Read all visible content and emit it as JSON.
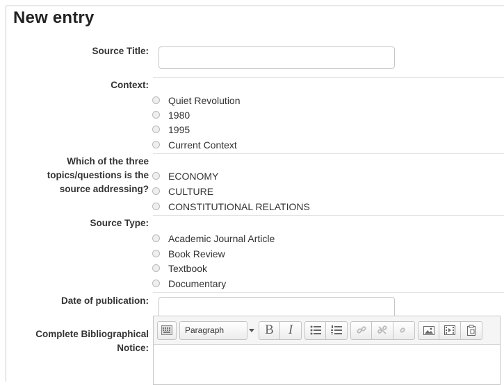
{
  "page": {
    "title": "New entry"
  },
  "fields": {
    "source_title": {
      "label": "Source Title:",
      "value": "",
      "placeholder": ""
    },
    "context": {
      "label": "Context:",
      "options": [
        "Quiet Revolution",
        "1980",
        "1995",
        "Current Context"
      ]
    },
    "topics": {
      "label_lines": [
        "Which of the three",
        "topics/questions is the",
        "source addressing?"
      ],
      "options": [
        "ECONOMY",
        "CULTURE",
        "CONSTITUTIONAL RELATIONS"
      ]
    },
    "source_type": {
      "label": "Source Type:",
      "options": [
        "Academic Journal Article",
        "Book Review",
        "Textbook",
        "Documentary"
      ]
    },
    "date": {
      "label": "Date of publication:",
      "value": "",
      "placeholder": ""
    },
    "bibliography": {
      "label_lines": [
        "Complete Bibliographical",
        "Notice:"
      ],
      "paragraph_format": "Paragraph",
      "icons": [
        "keyboard-icon",
        "bold-icon",
        "italic-icon",
        "bullet-list-icon",
        "numbered-list-icon",
        "link-icon",
        "unlink-icon",
        "anchor-icon",
        "image-icon",
        "media-icon",
        "paste-icon"
      ],
      "bold_glyph": "B",
      "italic_glyph": "I"
    }
  }
}
